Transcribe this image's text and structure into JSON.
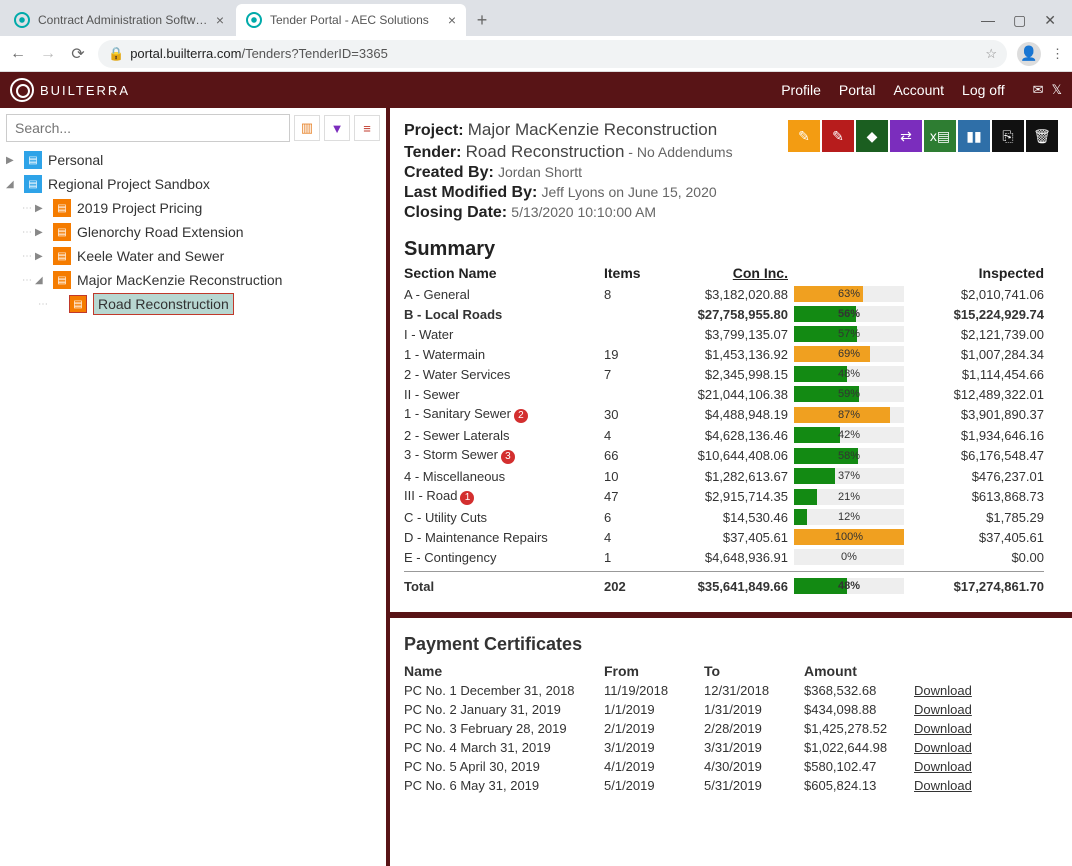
{
  "browser": {
    "tabs": [
      {
        "title": "Contract Administration Software"
      },
      {
        "title": "Tender Portal - AEC Solutions"
      }
    ],
    "url_host": "portal.builterra.com",
    "url_path": "/Tenders?TenderID=3365"
  },
  "header": {
    "brand": "BUILTERRA",
    "links": [
      "Profile",
      "Portal",
      "Account",
      "Log off"
    ]
  },
  "sidebar": {
    "search_placeholder": "Search...",
    "nodes": [
      {
        "label": "Personal",
        "icon": "folder-blue",
        "indent": 0,
        "caret": "▶"
      },
      {
        "label": "Regional Project Sandbox",
        "icon": "folder-blue",
        "indent": 0,
        "caret": "◢"
      },
      {
        "label": "2019 Project Pricing",
        "icon": "folder-orange",
        "indent": 1,
        "caret": "▶"
      },
      {
        "label": "Glenorchy Road Extension",
        "icon": "folder-orange",
        "indent": 1,
        "caret": "▶"
      },
      {
        "label": "Keele Water and Sewer",
        "icon": "folder-orange",
        "indent": 1,
        "caret": "▶"
      },
      {
        "label": "Major MacKenzie Reconstruction",
        "icon": "folder-orange",
        "indent": 1,
        "caret": "◢"
      },
      {
        "label": "Road Reconstruction",
        "icon": "folder-orange2",
        "indent": 2,
        "selected": true
      }
    ]
  },
  "project": {
    "project_label": "Project:",
    "project": "Major MacKenzie Reconstruction",
    "tender_label": "Tender:",
    "tender": "Road Reconstruction",
    "tender_sub": " - No Addendums",
    "created_label": "Created By:",
    "created": "Jordan Shortt",
    "modified_label": "Last Modified By:",
    "modified": "Jeff Lyons on June 15, 2020",
    "closing_label": "Closing Date:",
    "closing": "5/13/2020 10:10:00 AM"
  },
  "toolbar_colors": [
    "#f39c12",
    "#b71c1c",
    "#1b5e20",
    "#7b2dbd",
    "#2e7d32",
    "#2f6fa8",
    "#111",
    "#111"
  ],
  "summary": {
    "title": "Summary",
    "headers": {
      "section": "Section Name",
      "items": "Items",
      "con": "Con Inc.",
      "inspected": "Inspected"
    },
    "rows": [
      {
        "name": "A - General",
        "items": "8",
        "con": "$3,182,020.88",
        "pct": 63,
        "color": "orange",
        "insp": "$2,010,741.06"
      },
      {
        "name": "B - Local Roads",
        "items": "",
        "con": "$27,758,955.80",
        "pct": 56,
        "color": "green",
        "insp": "$15,224,929.74",
        "bold": true
      },
      {
        "name": "I - Water",
        "ind": 1,
        "items": "",
        "con": "$3,799,135.07",
        "pct": 57,
        "color": "green",
        "insp": "$2,121,739.00"
      },
      {
        "name": "1 - Watermain",
        "ind": 2,
        "items": "19",
        "con": "$1,453,136.92",
        "pct": 69,
        "color": "orange",
        "insp": "$1,007,284.34"
      },
      {
        "name": "2 - Water Services",
        "ind": 2,
        "items": "7",
        "con": "$2,345,998.15",
        "pct": 48,
        "color": "green",
        "insp": "$1,114,454.66"
      },
      {
        "name": "II - Sewer",
        "ind": 1,
        "items": "",
        "con": "$21,044,106.38",
        "pct": 59,
        "color": "green",
        "insp": "$12,489,322.01"
      },
      {
        "name": "1 - Sanitary Sewer",
        "ind": 2,
        "badge": "2",
        "items": "30",
        "con": "$4,488,948.19",
        "pct": 87,
        "color": "orange",
        "insp": "$3,901,890.37"
      },
      {
        "name": "2 - Sewer Laterals",
        "ind": 2,
        "items": "4",
        "con": "$4,628,136.46",
        "pct": 42,
        "color": "green",
        "insp": "$1,934,646.16"
      },
      {
        "name": "3 - Storm Sewer",
        "ind": 2,
        "badge": "3",
        "items": "66",
        "con": "$10,644,408.06",
        "pct": 58,
        "color": "green",
        "insp": "$6,176,548.47"
      },
      {
        "name": "4 - Miscellaneous",
        "ind": 2,
        "items": "10",
        "con": "$1,282,613.67",
        "pct": 37,
        "color": "green",
        "insp": "$476,237.01"
      },
      {
        "name": "III - Road",
        "ind": 1,
        "badge": "1",
        "items": "47",
        "con": "$2,915,714.35",
        "pct": 21,
        "color": "green",
        "insp": "$613,868.73"
      },
      {
        "name": "C - Utility Cuts",
        "items": "6",
        "con": "$14,530.46",
        "pct": 12,
        "color": "green",
        "insp": "$1,785.29"
      },
      {
        "name": "D - Maintenance Repairs",
        "items": "4",
        "con": "$37,405.61",
        "pct": 100,
        "color": "orange",
        "insp": "$37,405.61"
      },
      {
        "name": "E - Contingency",
        "items": "1",
        "con": "$4,648,936.91",
        "pct": 0,
        "color": "green",
        "insp": "$0.00"
      }
    ],
    "total": {
      "name": "Total",
      "items": "202",
      "con": "$35,641,849.66",
      "pct": 48,
      "color": "green",
      "insp": "$17,274,861.70"
    }
  },
  "pc": {
    "title": "Payment Certificates",
    "headers": {
      "name": "Name",
      "from": "From",
      "to": "To",
      "amount": "Amount"
    },
    "download": "Download",
    "rows": [
      {
        "name": "PC No. 1 December 31, 2018",
        "from": "11/19/2018",
        "to": "12/31/2018",
        "amount": "$368,532.68"
      },
      {
        "name": "PC No. 2 January 31, 2019",
        "from": "1/1/2019",
        "to": "1/31/2019",
        "amount": "$434,098.88"
      },
      {
        "name": "PC No. 3 February 28, 2019",
        "from": "2/1/2019",
        "to": "2/28/2019",
        "amount": "$1,425,278.52"
      },
      {
        "name": "PC No. 4 March 31, 2019",
        "from": "3/1/2019",
        "to": "3/31/2019",
        "amount": "$1,022,644.98"
      },
      {
        "name": "PC No. 5 April 30, 2019",
        "from": "4/1/2019",
        "to": "4/30/2019",
        "amount": "$580,102.47"
      },
      {
        "name": "PC No. 6 May 31, 2019",
        "from": "5/1/2019",
        "to": "5/31/2019",
        "amount": "$605,824.13"
      }
    ]
  }
}
